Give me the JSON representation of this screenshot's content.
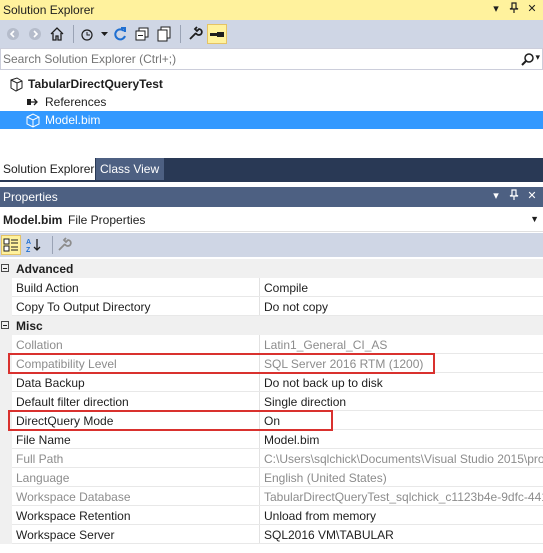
{
  "solution_explorer": {
    "title": "Solution Explorer",
    "pin_glyph": "▾",
    "pin2_glyph": "📌",
    "close_glyph": "✕",
    "search_placeholder": "Search Solution Explorer (Ctrl+;)",
    "project": "TabularDirectQueryTest",
    "references": "References",
    "model_file": "Model.bim"
  },
  "tabs": {
    "solution_explorer": "Solution Explorer",
    "class_view": "Class View"
  },
  "properties": {
    "title": "Properties",
    "object_name": "Model.bim",
    "object_kind": "File Properties",
    "dropdown_glyph": "▼",
    "categories": {
      "advanced": "Advanced",
      "misc": "Misc"
    },
    "advanced_rows": [
      {
        "name": "Build Action",
        "value": "Compile"
      },
      {
        "name": "Copy To Output Directory",
        "value": "Do not copy"
      }
    ],
    "misc_rows": [
      {
        "name": "Collation",
        "value": "Latin1_General_CI_AS"
      },
      {
        "name": "Compatibility Level",
        "value": "SQL Server 2016 RTM (1200)"
      },
      {
        "name": "Data Backup",
        "value": "Do not back up to disk"
      },
      {
        "name": "Default filter direction",
        "value": "Single direction"
      },
      {
        "name": "DirectQuery Mode",
        "value": "On"
      },
      {
        "name": "File Name",
        "value": "Model.bim"
      },
      {
        "name": "Full Path",
        "value": "C:\\Users\\sqlchick\\Documents\\Visual Studio 2015\\pro"
      },
      {
        "name": "Language",
        "value": "English (United States)"
      },
      {
        "name": "Workspace Database",
        "value": "TabularDirectQueryTest_sqlchick_c1123b4e-9dfc-441"
      },
      {
        "name": "Workspace Retention",
        "value": "Unload from memory"
      },
      {
        "name": "Workspace Server",
        "value": "SQL2016        VM\\TABULAR"
      }
    ]
  },
  "colors": {
    "title_yellow": "#fff29d",
    "selection_blue": "#3399ff",
    "tab_strip": "#293955",
    "highlight_red": "#d9312e"
  }
}
